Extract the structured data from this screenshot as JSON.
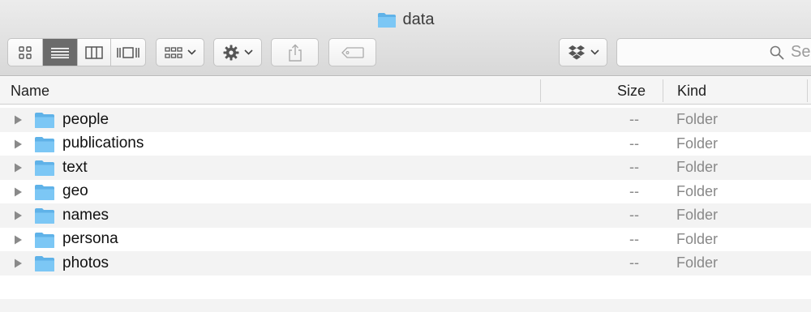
{
  "window": {
    "title": "data",
    "title_icon": "folder-icon"
  },
  "toolbar": {
    "view_modes": [
      "icon-view-icon",
      "list-view-icon",
      "column-view-icon",
      "cover-flow-icon"
    ],
    "active_view": "list-view-icon",
    "arrange": {
      "icon": "arrange-grid-icon"
    },
    "action": {
      "icon": "gear-icon"
    },
    "share": {
      "icon": "share-icon"
    },
    "tags": {
      "icon": "tag-icon"
    },
    "dropbox": {
      "icon": "dropbox-icon"
    },
    "search": {
      "placeholder": "Se"
    }
  },
  "columns": {
    "name": "Name",
    "size": "Size",
    "kind": "Kind"
  },
  "items": [
    {
      "name": "people",
      "size": "--",
      "kind": "Folder"
    },
    {
      "name": "publications",
      "size": "--",
      "kind": "Folder"
    },
    {
      "name": "text",
      "size": "--",
      "kind": "Folder"
    },
    {
      "name": "geo",
      "size": "--",
      "kind": "Folder"
    },
    {
      "name": "names",
      "size": "--",
      "kind": "Folder"
    },
    {
      "name": "persona",
      "size": "--",
      "kind": "Folder"
    },
    {
      "name": "photos",
      "size": "--",
      "kind": "Folder"
    }
  ],
  "colors": {
    "folder": "#7cc7f5",
    "folder_dark": "#5fb2e8",
    "accent_active": "#6b6b6b"
  }
}
